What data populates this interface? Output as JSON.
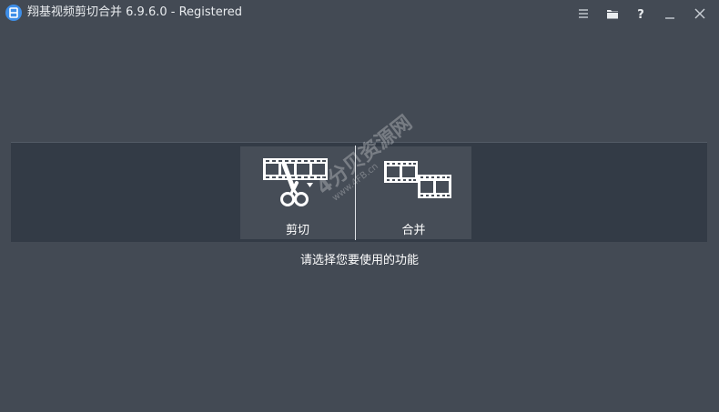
{
  "window": {
    "title": "翔基视频剪切合并 6.9.6.0 - Registered",
    "app_icon_glyph": "日"
  },
  "titlebar_buttons": [
    {
      "name": "menu-icon",
      "glyph": "hamburger"
    },
    {
      "name": "folder-icon",
      "glyph": "folder"
    },
    {
      "name": "help-icon",
      "glyph": "?"
    },
    {
      "name": "minimize-icon",
      "glyph": "minimize"
    },
    {
      "name": "close-icon",
      "glyph": "close"
    }
  ],
  "choices": {
    "cut": {
      "label": "剪切",
      "icon": "film-scissors-icon"
    },
    "merge": {
      "label": "合并",
      "icon": "film-merge-icon"
    }
  },
  "prompt": "请选择您要使用的功能",
  "watermark": {
    "brand": "4分贝资源网",
    "url": "www.4FB.cn"
  },
  "colors": {
    "background": "#434a54",
    "panel": "#333b46",
    "choice": "#464d57",
    "app_icon": "#3e8ee8"
  }
}
